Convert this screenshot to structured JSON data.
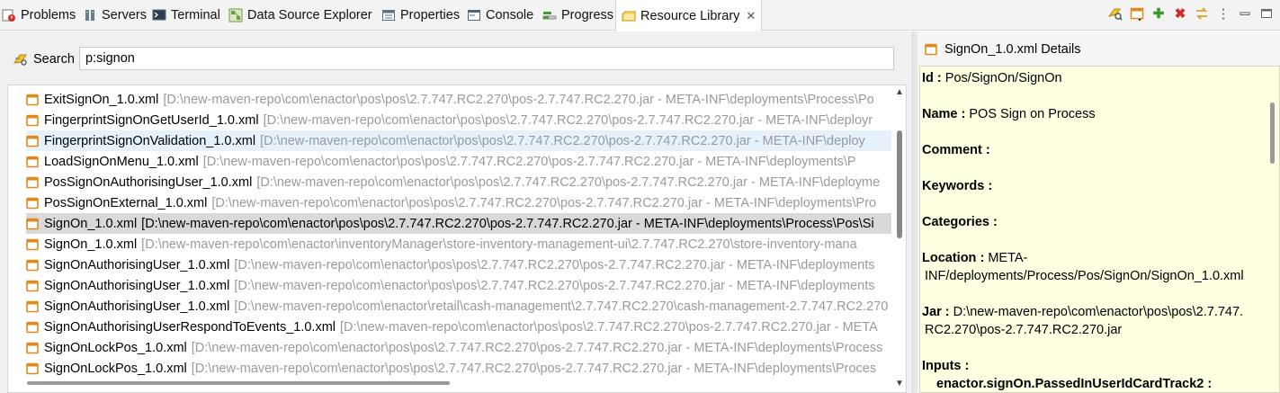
{
  "tabs": [
    {
      "label": "Problems",
      "icon": "problems-icon"
    },
    {
      "label": "Servers",
      "icon": "servers-icon"
    },
    {
      "label": "Terminal",
      "icon": "terminal-icon"
    },
    {
      "label": "Data Source Explorer",
      "icon": "data-source-icon"
    },
    {
      "label": "Properties",
      "icon": "properties-icon"
    },
    {
      "label": "Console",
      "icon": "console-icon"
    },
    {
      "label": "Progress",
      "icon": "progress-icon"
    },
    {
      "label": "Resource Library",
      "icon": "resource-library-icon",
      "active": true,
      "close": "✕"
    }
  ],
  "toolbar": {
    "icons": [
      "search-resource-icon",
      "open-file-icon",
      "add-icon",
      "remove-icon",
      "sync-icon",
      "view-menu-icon"
    ],
    "more": "⋮",
    "add": "✚",
    "remove": "✖"
  },
  "search": {
    "label": "Search",
    "value": "p:signon"
  },
  "results": [
    {
      "name": "ExitSignOn_1.0.xml",
      "path": "[D:\\new-maven-repo\\com\\enactor\\pos\\pos\\2.7.747.RC2.270\\pos-2.7.747.RC2.270.jar - META-INF\\deployments\\Process\\Po"
    },
    {
      "name": "FingerprintSignOnGetUserId_1.0.xml",
      "path": "[D:\\new-maven-repo\\com\\enactor\\pos\\pos\\2.7.747.RC2.270\\pos-2.7.747.RC2.270.jar - META-INF\\deployr"
    },
    {
      "name": "FingerprintSignOnValidation_1.0.xml",
      "path": "[D:\\new-maven-repo\\com\\enactor\\pos\\pos\\2.7.747.RC2.270\\pos-2.7.747.RC2.270.jar - META-INF\\deploy",
      "state": "hover"
    },
    {
      "name": "LoadSignOnMenu_1.0.xml",
      "path": "[D:\\new-maven-repo\\com\\enactor\\pos\\pos\\2.7.747.RC2.270\\pos-2.7.747.RC2.270.jar - META-INF\\deployments\\P"
    },
    {
      "name": "PosSignOnAuthorisingUser_1.0.xml",
      "path": "[D:\\new-maven-repo\\com\\enactor\\pos\\pos\\2.7.747.RC2.270\\pos-2.7.747.RC2.270.jar - META-INF\\deployme"
    },
    {
      "name": "PosSignOnExternal_1.0.xml",
      "path": "[D:\\new-maven-repo\\com\\enactor\\pos\\pos\\2.7.747.RC2.270\\pos-2.7.747.RC2.270.jar - META-INF\\deployments\\Pro"
    },
    {
      "name": "SignOn_1.0.xml",
      "path": "[D:\\new-maven-repo\\com\\enactor\\pos\\pos\\2.7.747.RC2.270\\pos-2.7.747.RC2.270.jar - META-INF\\deployments\\Process\\Pos\\Si",
      "state": "selected"
    },
    {
      "name": "SignOn_1.0.xml",
      "path": "[D:\\new-maven-repo\\com\\enactor\\inventoryManager\\store-inventory-management-ui\\2.7.747.RC2.270\\store-inventory-mana"
    },
    {
      "name": "SignOnAuthorisingUser_1.0.xml",
      "path": "[D:\\new-maven-repo\\com\\enactor\\pos\\pos\\2.7.747.RC2.270\\pos-2.7.747.RC2.270.jar - META-INF\\deployments"
    },
    {
      "name": "SignOnAuthorisingUser_1.0.xml",
      "path": "[D:\\new-maven-repo\\com\\enactor\\pos\\pos\\2.7.747.RC2.270\\pos-2.7.747.RC2.270.jar - META-INF\\deployments"
    },
    {
      "name": "SignOnAuthorisingUser_1.0.xml",
      "path": "[D:\\new-maven-repo\\com\\enactor\\retail\\cash-management\\2.7.747.RC2.270\\cash-management-2.7.747.RC2.270"
    },
    {
      "name": "SignOnAuthorisingUserRespondToEvents_1.0.xml",
      "path": "[D:\\new-maven-repo\\com\\enactor\\pos\\pos\\2.7.747.RC2.270\\pos-2.7.747.RC2.270.jar - META"
    },
    {
      "name": "SignOnLockPos_1.0.xml",
      "path": "[D:\\new-maven-repo\\com\\enactor\\pos\\pos\\2.7.747.RC2.270\\pos-2.7.747.RC2.270.jar - META-INF\\deployments\\Process"
    },
    {
      "name": "SignOnLockPos_1.0.xml",
      "path": "[D:\\new-maven-repo\\com\\enactor\\pos\\pos\\2.7.747.RC2.270\\pos-2.7.747.RC2.270.jar - META-INF\\deployments\\Proces"
    }
  ],
  "details": {
    "title": "SignOn_1.0.xml Details",
    "id_label": "Id :",
    "id_value": "Pos/SignOn/SignOn",
    "name_label": "Name :",
    "name_value": "POS Sign on Process",
    "comment_label": "Comment :",
    "keywords_label": "Keywords :",
    "categories_label": "Categories :",
    "location_label": "Location :",
    "location_value_1": "META-",
    "location_value_2": "INF/deployments/Process/Pos/SignOn/SignOn_1.0.xml",
    "jar_label": "Jar :",
    "jar_value_1": "D:\\new-maven-repo\\com\\enactor\\pos\\pos\\2.7.747.",
    "jar_value_2": "RC2.270\\pos-2.7.747.RC2.270.jar",
    "inputs_label": "Inputs :",
    "input_1": "enactor.signOn.PassedInUserIdCardTrack2 :"
  },
  "colors": {
    "accent": "#e08a1e",
    "selected_row": "#d9d9d9",
    "hover_row": "#e5f1fb",
    "details_bg": "#ffffe1"
  }
}
